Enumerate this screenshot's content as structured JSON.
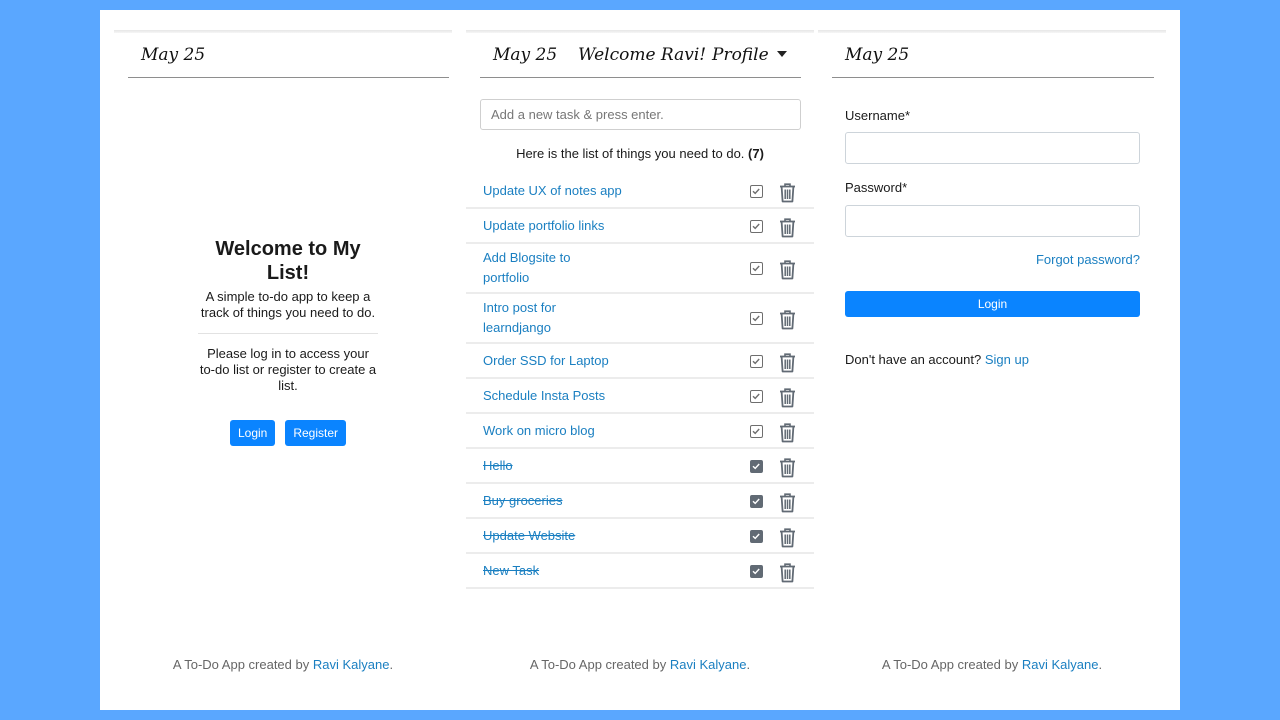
{
  "colors": {
    "background": "#5aa7ff",
    "accent": "#0a84ff",
    "link": "#1a7fc1"
  },
  "panel1": {
    "date": "May 25",
    "heading": "Welcome to My List!",
    "subtext": "A simple to-do app to keep a track of things you need to do.",
    "note": "Please log in to access your to-do list or register to create a list.",
    "login_label": "Login",
    "register_label": "Register"
  },
  "panel2": {
    "date": "May 25",
    "welcome": "Welcome Ravi!",
    "profile_label": "Profile",
    "input_placeholder": "Add a new task & press enter.",
    "count_text": "Here is the list of things you need to do.",
    "count_value": "(7)",
    "tasks": [
      {
        "text": "Update UX of notes app",
        "done": false
      },
      {
        "text": "Update portfolio links",
        "done": false
      },
      {
        "text": "Add Blogsite to portfolio",
        "done": false
      },
      {
        "text": "Intro post for learndjango",
        "done": false
      },
      {
        "text": "Order SSD for Laptop",
        "done": false
      },
      {
        "text": "Schedule Insta Posts",
        "done": false
      },
      {
        "text": "Work on micro blog",
        "done": false
      },
      {
        "text": "Hello",
        "done": true
      },
      {
        "text": "Buy groceries",
        "done": true
      },
      {
        "text": "Update Website",
        "done": true
      },
      {
        "text": "New Task",
        "done": true
      }
    ]
  },
  "panel3": {
    "date": "May 25",
    "username_label": "Username*",
    "password_label": "Password*",
    "forgot_label": "Forgot password?",
    "login_label": "Login",
    "signup_prompt": "Don't have an account?",
    "signup_label": "Sign up"
  },
  "footer": {
    "prefix": "A To-Do App created by",
    "author": "Ravi Kalyane",
    "suffix": "."
  }
}
